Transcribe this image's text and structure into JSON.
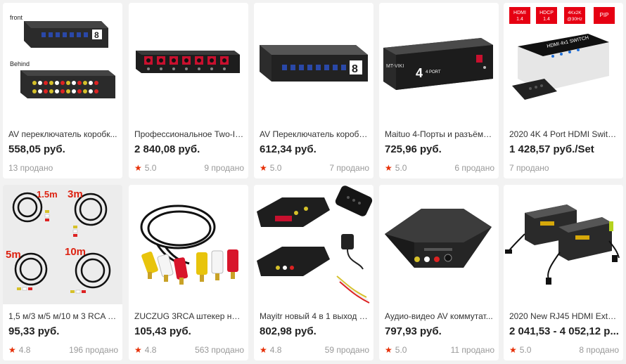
{
  "products": [
    {
      "title": "AV переключатель коробк...",
      "price": "558,05 руб.",
      "rating": "",
      "sold": "13 продано",
      "image_labels": [
        "front",
        "Behind"
      ]
    },
    {
      "title": "Профессиональное Two-In...",
      "price": "2 840,08 руб.",
      "rating": "5.0",
      "sold": "9 продано",
      "image_labels": []
    },
    {
      "title": "AV Переключатель коробк...",
      "price": "612,34 руб.",
      "rating": "5.0",
      "sold": "7 продано",
      "image_labels": []
    },
    {
      "title": "Maituo 4-Порты и разъёмы...",
      "price": "725,96 руб.",
      "rating": "5.0",
      "sold": "6 продано",
      "image_labels": [
        "MT-VIKI",
        "4 PORT"
      ]
    },
    {
      "title": "2020 4K 4 Port HDMI Switch ...",
      "price": "1 428,57 руб./Set",
      "rating": "",
      "sold": "7 продано",
      "image_labels": [
        "HDMI 1.4",
        "HDCP 1.4",
        "4Kx2K @30Hz",
        "PIP",
        "HDMI 4x1 SWITCH"
      ]
    },
    {
      "title": "1,5 м/3 м/5 м/10 м 3 RCA к ...",
      "price": "95,33 руб.",
      "rating": "4.8",
      "sold": "196 продано",
      "image_labels": [
        "1.5m",
        "3m",
        "5m",
        "10m"
      ]
    },
    {
      "title": "ZUCZUG 3RCA штекер на 3 ...",
      "price": "105,43 руб.",
      "rating": "4.8",
      "sold": "563 продано",
      "image_labels": []
    },
    {
      "title": "Mayitr новый 4 в 1 выход S...",
      "price": "802,98 руб.",
      "rating": "4.8",
      "sold": "59 продано",
      "image_labels": []
    },
    {
      "title": "Аудио-видео AV коммутат...",
      "price": "797,93 руб.",
      "rating": "5.0",
      "sold": "11 продано",
      "image_labels": []
    },
    {
      "title": "2020 New RJ45 HDMI Extend...",
      "price": "2 041,53 - 4 052,12 р...",
      "rating": "5.0",
      "sold": "8 продано",
      "image_labels": []
    }
  ],
  "colors": {
    "star": "#e62e04",
    "meta": "#999999",
    "price": "#222222"
  }
}
